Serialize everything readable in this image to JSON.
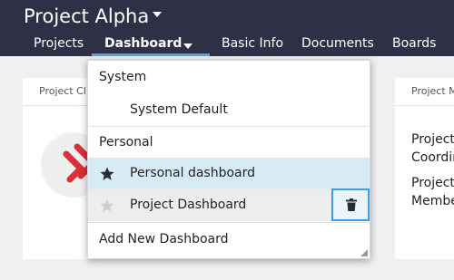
{
  "header": {
    "project_title": "Project Alpha",
    "nav": {
      "projects": "Projects",
      "dashboard": "Dashboard",
      "basic_info": "Basic Info",
      "documents": "Documents",
      "boards": "Boards"
    }
  },
  "cards": {
    "left_title": "Project Cl",
    "right_title": "Project M",
    "right_lines": [
      "Project",
      "Coordin",
      "Project",
      "Membe"
    ]
  },
  "dropdown": {
    "system_header": "System",
    "system_items": [
      "System Default"
    ],
    "personal_header": "Personal",
    "personal_items": [
      "Personal dashboard",
      "Project Dashboard"
    ],
    "add_new": "Add New Dashboard"
  },
  "colors": {
    "header_bg": "#2f2f45",
    "active_underline": "#4ea7e0",
    "selected_row_bg": "#d7ebf7",
    "hover_row_bg": "#ededed",
    "focus_border": "#3aa0e6",
    "logo_red": "#d9303b"
  },
  "icons": {
    "title_caret": "caret-down-icon",
    "dashboard_caret": "caret-down-icon",
    "personal_star": "star-filled-icon",
    "project_star": "star-outline-icon",
    "delete": "trash-icon"
  }
}
